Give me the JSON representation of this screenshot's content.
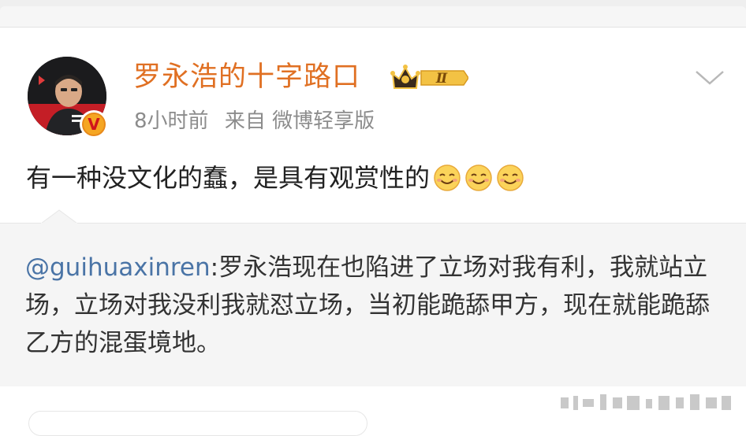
{
  "post": {
    "username": "罗永浩的十字路口",
    "vip_level": "Ⅱ",
    "verified_mark": "V",
    "time": "8小时前",
    "source": "来自 微博轻享版",
    "text": "有一种没文化的蠢，是具有观赏性的",
    "emoji_count": 3
  },
  "repost": {
    "mention": "@guihuaxinren",
    "text": ":罗永浩现在也陷进了立场对我有利，我就站立场，立场对我没利我就怼立场，当初能跪舔甲方，现在就能跪舔乙方的混蛋境地。"
  },
  "colors": {
    "username": "#e07023",
    "mention": "#4a74a6",
    "meta": "#8c8c8c",
    "repost_bg": "#f5f5f5"
  },
  "icons": [
    "crown-icon",
    "verified-icon",
    "chevron-down-icon",
    "smile-emoji-icon"
  ]
}
